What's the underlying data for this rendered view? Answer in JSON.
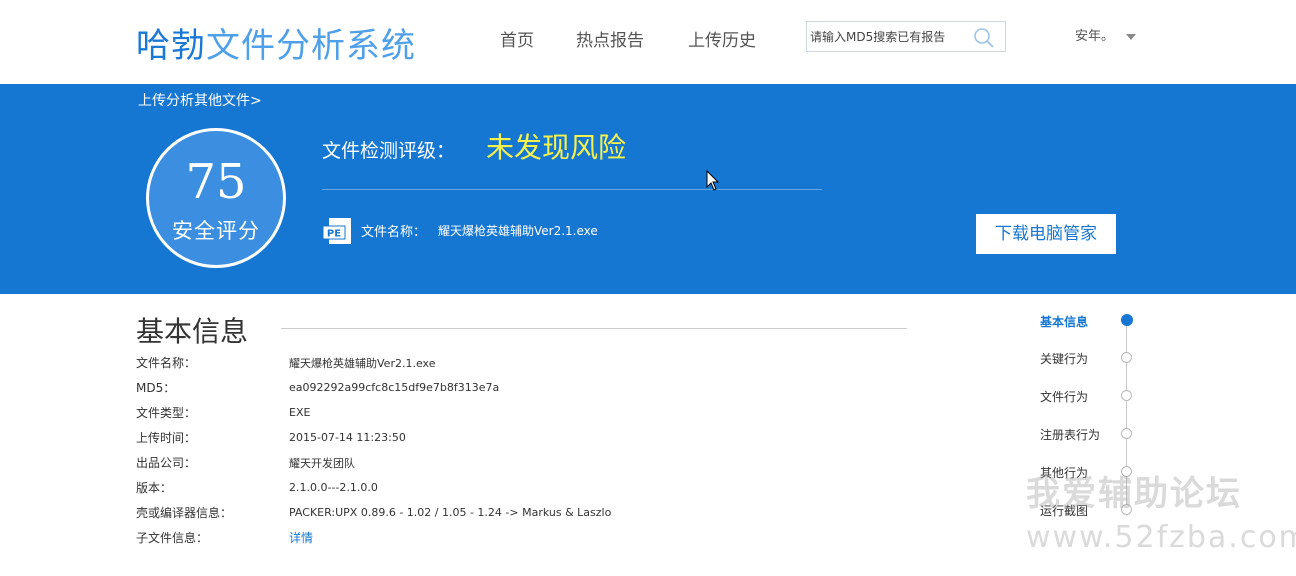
{
  "header": {
    "logo_part1": "哈勃",
    "logo_part2": "文件分析系统",
    "nav": [
      "首页",
      "热点报告",
      "上传历史"
    ],
    "search_placeholder": "请输入MD5搜索已有报告",
    "user_name": "安年。"
  },
  "banner": {
    "upload_link": "上传分析其他文件>",
    "score": "75",
    "score_label": "安全评分",
    "rating_label": "文件检测评级：",
    "rating_value": "未发现风险",
    "file_name_label": "文件名称：",
    "file_name": "耀天爆枪英雄辅助Ver2.1.exe",
    "download_button": "下载电脑管家",
    "pe_badge": "PE"
  },
  "basic_info": {
    "title": "基本信息",
    "rows": [
      {
        "label": "文件名称：",
        "value": "耀天爆枪英雄辅助Ver2.1.exe"
      },
      {
        "label": "MD5：",
        "value": "ea092292a99cfc8c15df9e7b8f313e7a"
      },
      {
        "label": "文件类型：",
        "value": "EXE"
      },
      {
        "label": "上传时间：",
        "value": "2015-07-14 11:23:50"
      },
      {
        "label": "出品公司：",
        "value": "耀天开发团队"
      },
      {
        "label": "版本：",
        "value": "2.1.0.0---2.1.0.0"
      },
      {
        "label": "壳或编译器信息：",
        "value": "PACKER:UPX 0.89.6 - 1.02 / 1.05 - 1.24 -> Markus & Laszlo"
      },
      {
        "label": "子文件信息：",
        "value": "详情"
      }
    ]
  },
  "side_nav": {
    "items": [
      "基本信息",
      "关键行为",
      "文件行为",
      "注册表行为",
      "其他行为",
      "运行截图"
    ],
    "active_index": 0
  },
  "watermark": {
    "line1": "我爱辅助论坛",
    "line2": "www.52fzba.com"
  },
  "colors": {
    "brand_blue": "#1677d2",
    "rating_yellow": "#f6f24a"
  },
  "icons": [
    "search-icon",
    "caret-down-icon",
    "pe-file-icon",
    "mouse-cursor-icon"
  ]
}
